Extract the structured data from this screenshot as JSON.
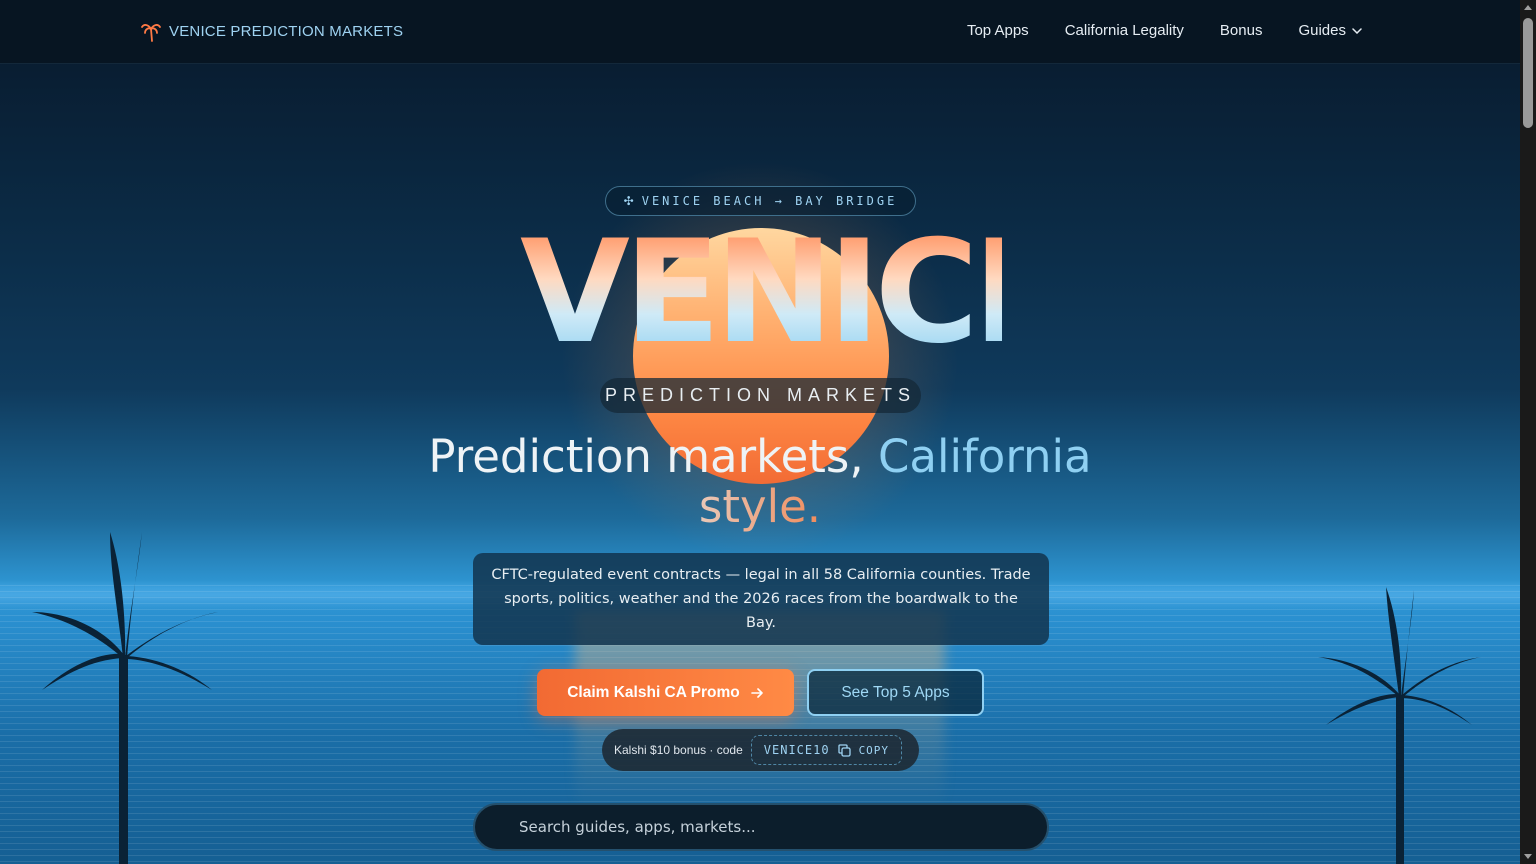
{
  "header": {
    "brand": "VENICE PREDICTION MARKETS",
    "nav": [
      {
        "label": "Top Apps"
      },
      {
        "label": "California Legality"
      },
      {
        "label": "Bonus"
      },
      {
        "label": "Guides"
      }
    ]
  },
  "hero": {
    "eyebrow": "VENICE BEACH → BAY BRIDGE",
    "title": "VENICE",
    "subtitle": "PREDICTION MARKETS",
    "headline_main": "Prediction markets, ",
    "headline_accent": "California",
    "headline_tail": "style.",
    "description": "CFTC-regulated event contracts — legal in all 58 California counties. Trade sports, politics, weather and the 2026 races from the boardwalk to the Bay.",
    "primary_button": "Claim Kalshi CA Promo",
    "secondary_button": "See Top 5 Apps",
    "promo_label": "Kalshi $10 bonus · code",
    "promo_code": "VENICE10",
    "copy_label": "COPY",
    "search_placeholder": "Search guides, apps, markets..."
  },
  "colors": {
    "accent_orange": "#ff8a45",
    "accent_blue": "#8fd0f2",
    "nav_bg": "#071522"
  },
  "icons": {
    "logo": "palm-tree-icon",
    "eyebrow": "sparkle-icon",
    "dropdown": "chevron-down-icon",
    "arrow": "arrow-right-icon",
    "copy": "copy-icon",
    "search": "search-icon"
  }
}
